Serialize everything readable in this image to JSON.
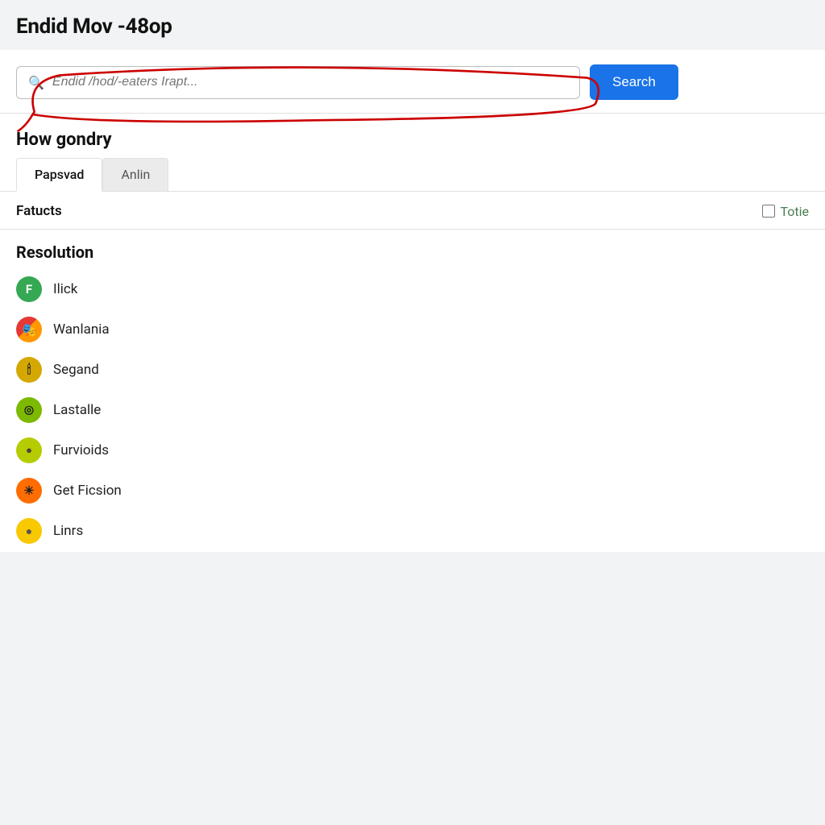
{
  "header": {
    "title": "Endid Mov -48op"
  },
  "search": {
    "placeholder": "Endid /hod/-eaters Irapt...",
    "button_label": "Search",
    "icon": "search-icon"
  },
  "section": {
    "title": "How gondry"
  },
  "tabs": [
    {
      "label": "Papsvad",
      "active": true
    },
    {
      "label": "Anlin",
      "active": false
    }
  ],
  "fatucts": {
    "label": "Fatucts",
    "totie_label": "Totie",
    "checkbox_checked": false
  },
  "resolution": {
    "title": "Resolution",
    "items": [
      {
        "name": "Ilick",
        "icon_type": "green",
        "icon_letter": "F"
      },
      {
        "name": "Wanlania",
        "icon_type": "multi",
        "icon_letter": "🎭"
      },
      {
        "name": "Segand",
        "icon_type": "yellow",
        "icon_letter": "🕯"
      },
      {
        "name": "Lastalle",
        "icon_type": "olive",
        "icon_letter": "🌀"
      },
      {
        "name": "Furvioids",
        "icon_type": "lime",
        "icon_letter": "💚"
      },
      {
        "name": "Get Ficsion",
        "icon_type": "sunflower",
        "icon_letter": "☀"
      },
      {
        "name": "Linrs",
        "icon_type": "gold",
        "icon_letter": "🟡"
      }
    ]
  }
}
